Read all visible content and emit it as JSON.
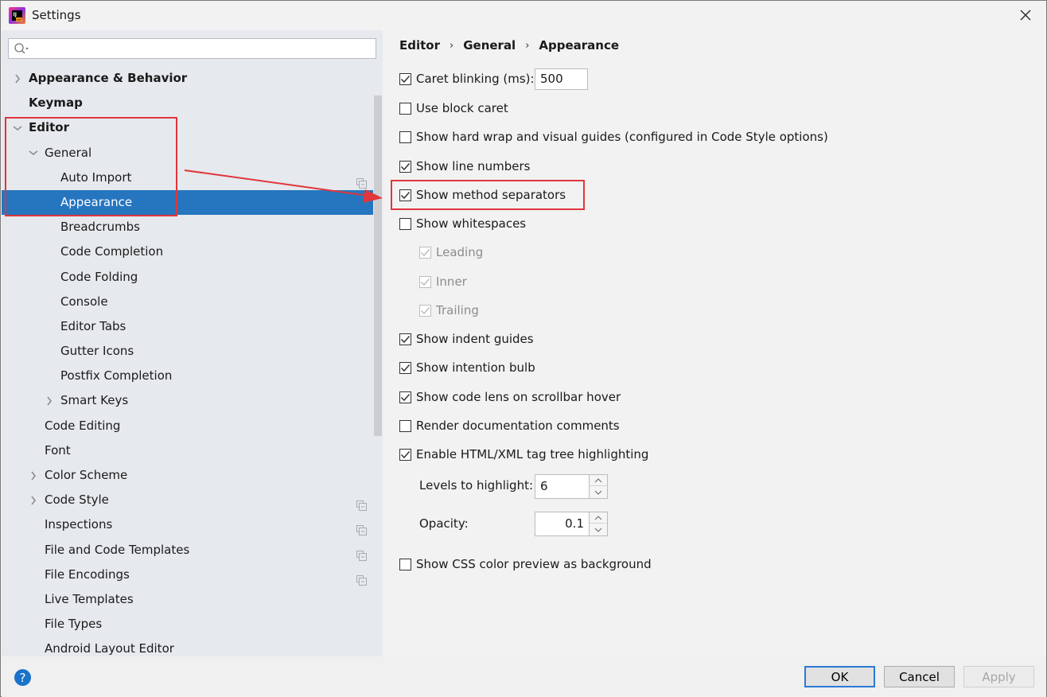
{
  "window": {
    "title": "Settings",
    "app_icon": "intellij-idea-icon",
    "close_icon": "close-icon"
  },
  "sidebar": {
    "search": {
      "value": "",
      "placeholder": ""
    },
    "items": [
      {
        "label": "Appearance & Behavior",
        "level": 0,
        "bold": true,
        "expander": "collapsed"
      },
      {
        "label": "Keymap",
        "level": 0,
        "bold": true,
        "expander": "none"
      },
      {
        "label": "Editor",
        "level": 0,
        "bold": true,
        "expander": "expanded"
      },
      {
        "label": "General",
        "level": 1,
        "bold": false,
        "expander": "expanded"
      },
      {
        "label": "Auto Import",
        "level": 2,
        "bold": false,
        "expander": "none",
        "project_icon": true
      },
      {
        "label": "Appearance",
        "level": 2,
        "bold": false,
        "expander": "none",
        "selected": true
      },
      {
        "label": "Breadcrumbs",
        "level": 2,
        "bold": false,
        "expander": "none"
      },
      {
        "label": "Code Completion",
        "level": 2,
        "bold": false,
        "expander": "none"
      },
      {
        "label": "Code Folding",
        "level": 2,
        "bold": false,
        "expander": "none"
      },
      {
        "label": "Console",
        "level": 2,
        "bold": false,
        "expander": "none"
      },
      {
        "label": "Editor Tabs",
        "level": 2,
        "bold": false,
        "expander": "none"
      },
      {
        "label": "Gutter Icons",
        "level": 2,
        "bold": false,
        "expander": "none"
      },
      {
        "label": "Postfix Completion",
        "level": 2,
        "bold": false,
        "expander": "none"
      },
      {
        "label": "Smart Keys",
        "level": 2,
        "bold": false,
        "expander": "collapsed"
      },
      {
        "label": "Code Editing",
        "level": 1,
        "bold": false,
        "expander": "none"
      },
      {
        "label": "Font",
        "level": 1,
        "bold": false,
        "expander": "none"
      },
      {
        "label": "Color Scheme",
        "level": 1,
        "bold": false,
        "expander": "collapsed"
      },
      {
        "label": "Code Style",
        "level": 1,
        "bold": false,
        "expander": "collapsed",
        "project_icon": true
      },
      {
        "label": "Inspections",
        "level": 1,
        "bold": false,
        "expander": "none",
        "project_icon": true
      },
      {
        "label": "File and Code Templates",
        "level": 1,
        "bold": false,
        "expander": "none",
        "project_icon": true
      },
      {
        "label": "File Encodings",
        "level": 1,
        "bold": false,
        "expander": "none",
        "project_icon": true
      },
      {
        "label": "Live Templates",
        "level": 1,
        "bold": false,
        "expander": "none"
      },
      {
        "label": "File Types",
        "level": 1,
        "bold": false,
        "expander": "none"
      },
      {
        "label": "Android Layout Editor",
        "level": 1,
        "bold": false,
        "expander": "none"
      }
    ]
  },
  "main": {
    "breadcrumb": [
      "Editor",
      "General",
      "Appearance"
    ],
    "breadcrumb_sep": "›",
    "caret_blinking": {
      "label": "Caret blinking (ms):",
      "checked": true,
      "value": "500"
    },
    "options": [
      {
        "label": "Use block caret",
        "checked": false,
        "disabled": false,
        "indent": false
      },
      {
        "label": "Show hard wrap and visual guides (configured in Code Style options)",
        "checked": false,
        "disabled": false,
        "indent": false
      },
      {
        "label": "Show line numbers",
        "checked": true,
        "disabled": false,
        "indent": false
      },
      {
        "label": "Show method separators",
        "checked": true,
        "disabled": false,
        "indent": false,
        "highlighted": true
      },
      {
        "label": "Show whitespaces",
        "checked": false,
        "disabled": false,
        "indent": false
      },
      {
        "label": "Leading",
        "checked": true,
        "disabled": true,
        "indent": true
      },
      {
        "label": "Inner",
        "checked": true,
        "disabled": true,
        "indent": true
      },
      {
        "label": "Trailing",
        "checked": true,
        "disabled": true,
        "indent": true
      },
      {
        "label": "Show indent guides",
        "checked": true,
        "disabled": false,
        "indent": false
      },
      {
        "label": "Show intention bulb",
        "checked": true,
        "disabled": false,
        "indent": false
      },
      {
        "label": "Show code lens on scrollbar hover",
        "checked": true,
        "disabled": false,
        "indent": false
      },
      {
        "label": "Render documentation comments",
        "checked": false,
        "disabled": false,
        "indent": false
      },
      {
        "label": "Enable HTML/XML tag tree highlighting",
        "checked": true,
        "disabled": false,
        "indent": false
      }
    ],
    "levels_to_highlight": {
      "label": "Levels to highlight:",
      "value": "6"
    },
    "opacity": {
      "label": "Opacity:",
      "value": "0.1"
    },
    "css_preview": {
      "label": "Show CSS color preview as background",
      "checked": false
    }
  },
  "footer": {
    "help_label": "?",
    "ok_label": "OK",
    "cancel_label": "Cancel",
    "apply_label": "Apply",
    "apply_disabled": true
  },
  "annotation": {
    "color": "#e0363c",
    "note": "red boxes around Editor>General>Appearance tree path and 'Show method separators' option, connected by arrow"
  },
  "colors": {
    "selection": "#2675bf",
    "sidebar_bg": "#e6e9ed",
    "panel_bg": "#f2f2f2",
    "help_blue": "#1a73c9"
  }
}
